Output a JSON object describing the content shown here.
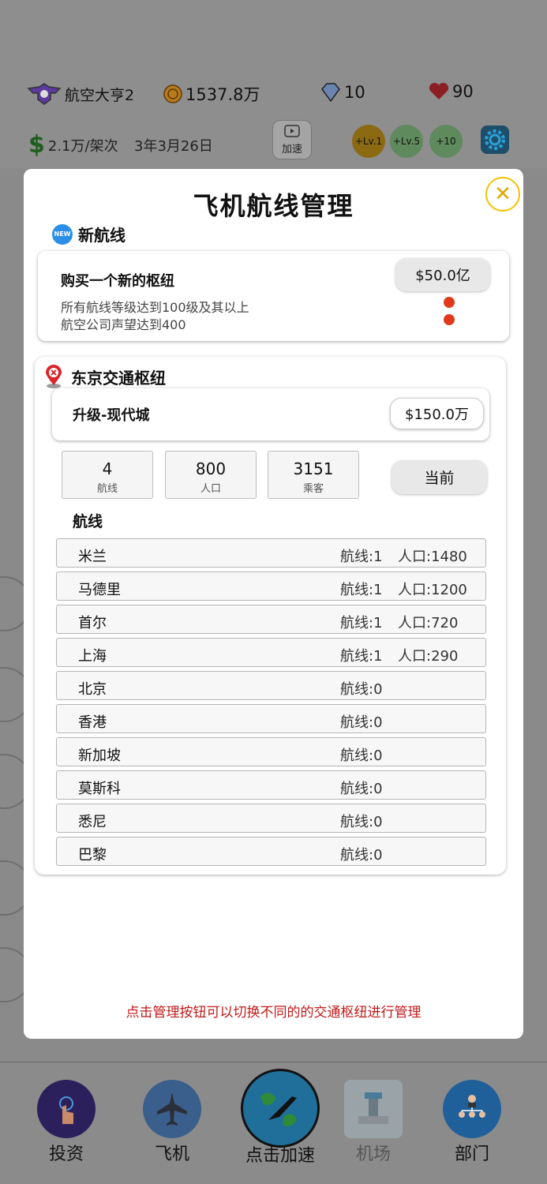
{
  "header": {
    "player_name": "航空大亨2",
    "coins": "1537.8万",
    "diamonds": "10",
    "hearts": "90",
    "income_rate": "2.1万/架次",
    "game_date": "3年3月26日",
    "speed_label": "加速",
    "boosts": [
      "+Lv.1",
      "+Lv.5",
      "+10"
    ]
  },
  "modal": {
    "title": "飞机航线管理",
    "close_icon": "close-icon",
    "new_route": {
      "section_label": "新航线",
      "badge": "NEW",
      "card_title": "购买一个新的枢纽",
      "price": "$50.0亿",
      "requirements": [
        "所有航线等级达到100级及其以上",
        "航空公司声望达到400"
      ]
    },
    "hub": {
      "name": "东京交通枢纽",
      "upgrade_label": "升级-现代城",
      "upgrade_price": "$150.0万",
      "stats": [
        {
          "value": "4",
          "label": "航线"
        },
        {
          "value": "800",
          "label": "人口"
        },
        {
          "value": "3151",
          "label": "乘客"
        }
      ],
      "current_button": "当前",
      "routes_heading": "航线",
      "routes": [
        {
          "city": "米兰",
          "routes": "航线:1",
          "population": "人口:1480"
        },
        {
          "city": "马德里",
          "routes": "航线:1",
          "population": "人口:1200"
        },
        {
          "city": "首尔",
          "routes": "航线:1",
          "population": "人口:720"
        },
        {
          "city": "上海",
          "routes": "航线:1",
          "population": "人口:290"
        },
        {
          "city": "北京",
          "routes": "航线:0",
          "population": ""
        },
        {
          "city": "香港",
          "routes": "航线:0",
          "population": ""
        },
        {
          "city": "新加坡",
          "routes": "航线:0",
          "population": ""
        },
        {
          "city": "莫斯科",
          "routes": "航线:0",
          "population": ""
        },
        {
          "city": "悉尼",
          "routes": "航线:0",
          "population": ""
        },
        {
          "city": "巴黎",
          "routes": "航线:0",
          "population": ""
        }
      ]
    },
    "hint": "点击管理按钮可以切换不同的的交通枢纽进行管理"
  },
  "nav": [
    {
      "label": "投资",
      "icon": "invest-icon"
    },
    {
      "label": "飞机",
      "icon": "airplane-icon"
    },
    {
      "label": "点击加速",
      "icon": "globe-airplane-icon"
    },
    {
      "label": "机场",
      "icon": "airport-tower-icon"
    },
    {
      "label": "部门",
      "icon": "department-icon"
    }
  ],
  "colors": {
    "accent_close": "#f2c200",
    "hint_red": "#c11a1a",
    "req_dot": "#e03a1c",
    "new_badge": "#2b8fe8"
  }
}
